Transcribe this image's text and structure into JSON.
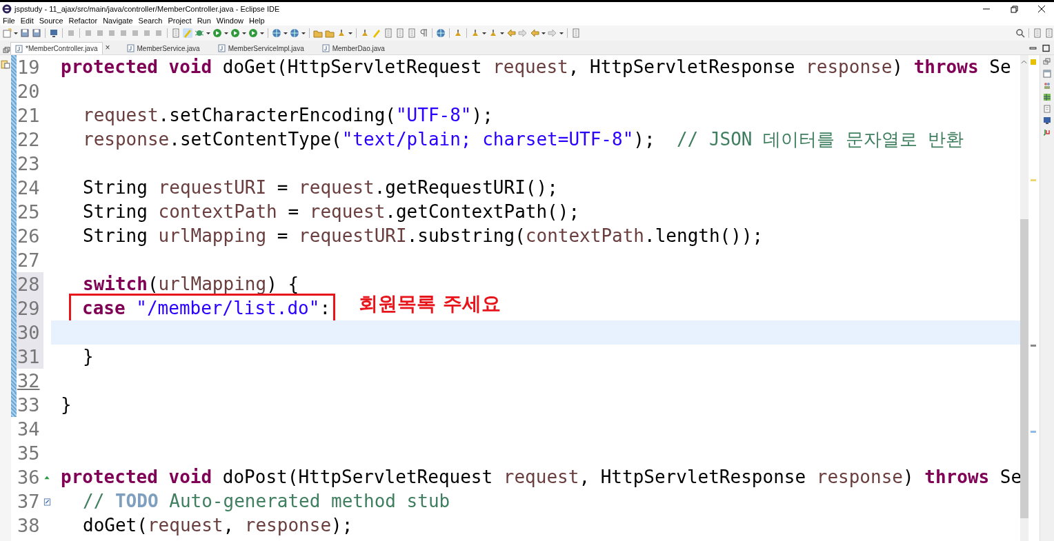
{
  "window": {
    "title": "jspstudy - 11_ajax/src/main/java/controller/MemberController.java - Eclipse IDE"
  },
  "menu": [
    "File",
    "Edit",
    "Source",
    "Refactor",
    "Navigate",
    "Search",
    "Project",
    "Run",
    "Window",
    "Help"
  ],
  "tabs": [
    {
      "label": "*MemberController.java",
      "selected": true,
      "close": "×"
    },
    {
      "label": "MemberService.java",
      "selected": false
    },
    {
      "label": "MemberServiceImpl.java",
      "selected": false
    },
    {
      "label": "MemberDao.java",
      "selected": false
    }
  ],
  "editor": {
    "lines": [
      {
        "number": "19",
        "indented": false,
        "changed": true,
        "ranged": false,
        "current": false,
        "tokens": [
          {
            "kind": "keyword",
            "text": "protected void"
          },
          {
            "kind": "plain",
            "text": " doGet(HttpServletRequest "
          },
          {
            "kind": "variable",
            "text": "request"
          },
          {
            "kind": "plain",
            "text": ", HttpServletResponse "
          },
          {
            "kind": "variable",
            "text": "response"
          },
          {
            "kind": "plain",
            "text": ") "
          },
          {
            "kind": "keyword",
            "text": "throws"
          },
          {
            "kind": "plain",
            "text": " Se"
          }
        ]
      },
      {
        "number": "20",
        "indented": false,
        "changed": true,
        "ranged": false,
        "current": false
      },
      {
        "number": "21",
        "indented": true,
        "changed": true,
        "ranged": false,
        "current": false,
        "tokens": [
          {
            "kind": "variable",
            "text": "request"
          },
          {
            "kind": "plain",
            "text": ".setCharacterEncoding("
          },
          {
            "kind": "string",
            "text": "\"UTF-8\""
          },
          {
            "kind": "plain",
            "text": ");"
          }
        ]
      },
      {
        "number": "22",
        "indented": true,
        "changed": true,
        "ranged": false,
        "current": false,
        "tokens": [
          {
            "kind": "variable",
            "text": "response"
          },
          {
            "kind": "plain",
            "text": ".setContentType("
          },
          {
            "kind": "string",
            "text": "\"text/plain; charset=UTF-8\""
          },
          {
            "kind": "plain",
            "text": ");  "
          },
          {
            "kind": "comment",
            "text": "// JSON 데이터를 문자열로 반환"
          }
        ]
      },
      {
        "number": "23",
        "indented": false,
        "changed": true,
        "ranged": false,
        "current": false
      },
      {
        "number": "24",
        "indented": true,
        "changed": true,
        "ranged": false,
        "current": false,
        "tokens": [
          {
            "kind": "plain",
            "text": "String "
          },
          {
            "kind": "variable",
            "text": "requestURI"
          },
          {
            "kind": "plain",
            "text": " = "
          },
          {
            "kind": "variable",
            "text": "request"
          },
          {
            "kind": "plain",
            "text": ".getRequestURI();"
          }
        ]
      },
      {
        "number": "25",
        "indented": true,
        "changed": true,
        "ranged": false,
        "current": false,
        "tokens": [
          {
            "kind": "plain",
            "text": "String "
          },
          {
            "kind": "variable",
            "text": "contextPath"
          },
          {
            "kind": "plain",
            "text": " = "
          },
          {
            "kind": "variable",
            "text": "request"
          },
          {
            "kind": "plain",
            "text": ".getContextPath();"
          }
        ]
      },
      {
        "number": "26",
        "indented": true,
        "changed": true,
        "ranged": false,
        "current": false,
        "tokens": [
          {
            "kind": "plain",
            "text": "String "
          },
          {
            "kind": "variable",
            "text": "urlMapping"
          },
          {
            "kind": "plain",
            "text": " = "
          },
          {
            "kind": "variable",
            "text": "requestURI"
          },
          {
            "kind": "plain",
            "text": ".substring("
          },
          {
            "kind": "variable",
            "text": "contextPath"
          },
          {
            "kind": "plain",
            "text": ".length());"
          }
        ]
      },
      {
        "number": "27",
        "indented": false,
        "changed": true,
        "ranged": false,
        "current": false
      },
      {
        "number": "28",
        "indented": true,
        "changed": true,
        "ranged": true,
        "current": false,
        "tokens": [
          {
            "kind": "keyword",
            "text": "switch"
          },
          {
            "kind": "plain",
            "text": "("
          },
          {
            "kind": "variable",
            "text": "urlMapping"
          },
          {
            "kind": "plain",
            "text": ") {"
          }
        ]
      },
      {
        "number": "29",
        "indented": true,
        "changed": true,
        "ranged": true,
        "current": false,
        "boxed": true,
        "annotation": "회원목록 주세요",
        "tokens": [
          {
            "kind": "keyword",
            "text": "case "
          },
          {
            "kind": "string",
            "text": "\"/member/list.do\""
          },
          {
            "kind": "plain",
            "text": ":"
          }
        ]
      },
      {
        "number": "30",
        "indented": false,
        "changed": true,
        "ranged": true,
        "current": true
      },
      {
        "number": "31",
        "indented": true,
        "changed": true,
        "ranged": true,
        "current": false,
        "tokens": [
          {
            "kind": "plain",
            "text": "}"
          }
        ]
      },
      {
        "number": "32",
        "indented": false,
        "changed": true,
        "ranged": false,
        "current": false
      },
      {
        "number": "33",
        "indented": false,
        "changed": true,
        "ranged": false,
        "current": false,
        "tokens": [
          {
            "kind": "plain",
            "text": "}"
          }
        ]
      },
      {
        "number": "34",
        "indented": false,
        "changed": false,
        "ranged": false,
        "current": false
      },
      {
        "number": "35",
        "indented": false,
        "changed": false,
        "ranged": false,
        "current": false
      },
      {
        "number": "36",
        "indented": false,
        "changed": false,
        "ranged": false,
        "current": false,
        "gutter_icon": {
          "kind": "override"
        },
        "tokens": [
          {
            "kind": "keyword",
            "text": "protected void"
          },
          {
            "kind": "plain",
            "text": " doPost(HttpServletRequest "
          },
          {
            "kind": "variable",
            "text": "request"
          },
          {
            "kind": "plain",
            "text": ", HttpServletResponse "
          },
          {
            "kind": "variable",
            "text": "response"
          },
          {
            "kind": "plain",
            "text": ") "
          },
          {
            "kind": "keyword",
            "text": "throws"
          },
          {
            "kind": "plain",
            "text": " Se"
          }
        ]
      },
      {
        "number": "37",
        "indented": true,
        "changed": false,
        "ranged": false,
        "current": false,
        "gutter_icon": {
          "kind": "task"
        },
        "tokens": [
          {
            "kind": "comment",
            "text": "// "
          },
          {
            "kind": "todo",
            "text": "TODO"
          },
          {
            "kind": "comment",
            "text": " Auto-generated method stub"
          }
        ]
      },
      {
        "number": "38",
        "indented": true,
        "changed": false,
        "ranged": false,
        "current": false,
        "tokens": [
          {
            "kind": "plain",
            "text": "doGet("
          },
          {
            "kind": "variable",
            "text": "request"
          },
          {
            "kind": "plain",
            "text": ", "
          },
          {
            "kind": "variable",
            "text": "response"
          },
          {
            "kind": "plain",
            "text": ");"
          }
        ]
      }
    ]
  }
}
